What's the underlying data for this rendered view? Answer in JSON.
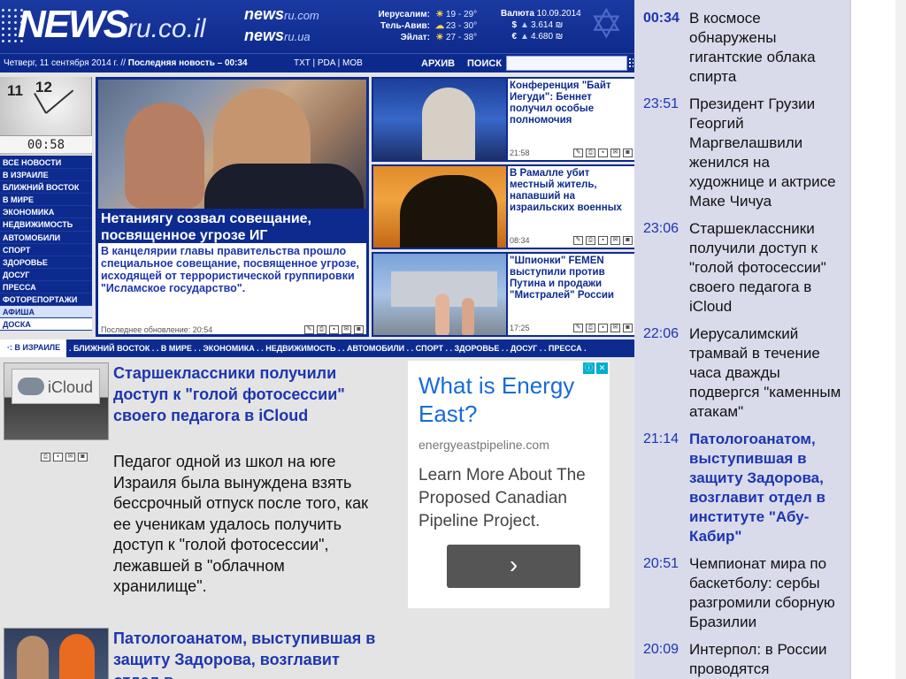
{
  "header": {
    "logo_bold": "NEWS",
    "logo_suffix": "ru.co.il",
    "mirrors": [
      {
        "bold": "news",
        "suffix": "ru.com"
      },
      {
        "bold": "news",
        "suffix": "ru.ua"
      }
    ],
    "weather": [
      {
        "city": "Иерусалим:",
        "icon": "sun-icon",
        "temp": "19 - 29°"
      },
      {
        "city": "Тель-Авив:",
        "icon": "sun-cloud-icon",
        "temp": "23 - 30°"
      },
      {
        "city": "Эйлат:",
        "icon": "sun-icon",
        "temp": "27 - 38°"
      }
    ],
    "currency": {
      "title": "Валюта",
      "date": "10.09.2014",
      "rows": [
        {
          "sym": "$",
          "dir": "up",
          "value": "3.614 ₪"
        },
        {
          "sym": "€",
          "dir": "up",
          "value": "4.680 ₪"
        }
      ]
    }
  },
  "topbar": {
    "date": "Четверг, 11 сентября 2014 г. //",
    "latest": "Последняя новость – 00:34",
    "formats": "TXT | PDA | MOB",
    "archive": "АРХИВ",
    "search": "ПОИСК",
    "search_value": ""
  },
  "clock": {
    "time": "00:58",
    "numbers": [
      "11",
      "12"
    ]
  },
  "nav": {
    "items": [
      "ВСЕ НОВОСТИ",
      "В ИЗРАИЛЕ",
      "БЛИЖНИЙ ВОСТОК",
      "В МИРЕ",
      "ЭКОНОМИКА",
      "НЕДВИЖИМОСТЬ",
      "АВТОМОБИЛИ",
      "СПОРТ",
      "ЗДОРОВЬЕ",
      "ДОСУГ",
      "ПРЕССА",
      "ФОТОРЕПОРТАЖИ",
      "АФИША",
      "ДОСКА"
    ]
  },
  "main_story": {
    "title": "Нетаниягу созвал совещание, посвященное угрозе ИГ",
    "text": "В канцелярии главы правительства прошло специальное совещание, посвященное угрозе, исходящей от террористической группировки \"Исламское государство\".",
    "updated": "Последнее обновление: 20:54"
  },
  "side_stories": [
    {
      "title": "Конференция \"Байт Иегуди\": Беннет получил особые полномочия",
      "time": "21:58"
    },
    {
      "title": "В Рамалле убит местный житель, напавший на израильских военных",
      "time": "08:34"
    },
    {
      "title": "\"Шпионки\" FEMEN выступили против Путина и продажи \"Мистралей\" России",
      "time": "17:25"
    }
  ],
  "catbar": {
    "current": "В ИЗРАИЛЕ",
    "rest": ". БЛИЖНИЙ ВОСТОК . . В МИРЕ . . ЭКОНОМИКА . . НЕДВИЖИМОСТЬ . . АВТОМОБИЛИ . . СПОРТ . . ЗДОРОВЬЕ . . ДОСУГ . . ПРЕССА ."
  },
  "articles": [
    {
      "title": "Старшеклассники получили доступ к \"голой фотосессии\" своего педагога в iCloud",
      "text": "Педагог одной из школ на юге Израиля была вынуждена взять бессрочный отпуск после того, как ее ученикам удалось получить доступ к \"голой фотосессии\", лежавшей в \"облачном хранилище\".",
      "thumb_label": "iCloud"
    },
    {
      "title": "Патологоанатом, выступившая в защиту Задорова, возглавит отдел в"
    }
  ],
  "ad": {
    "headline": "What is Energy East?",
    "url": "energyeastpipeline.com",
    "text": "Learn More About The Proposed Canadian Pipeline Project.",
    "button": "›"
  },
  "news_feed": [
    {
      "time": "00:34",
      "title": "В космосе обнаружены гигантские облака спирта",
      "highlight": false
    },
    {
      "time": "23:51",
      "title": "Президент Грузии Георгий Маргвелашвили женился на художнице и актрисе Маке Чичуа",
      "highlight": false
    },
    {
      "time": "23:06",
      "title": "Старшеклассники получили доступ к \"голой фотосессии\" своего педагога в iCloud",
      "highlight": false
    },
    {
      "time": "22:06",
      "title": "Иерусалимский трамвай в течение часа дважды подвергся \"каменным атакам\"",
      "highlight": false
    },
    {
      "time": "21:14",
      "title": "Патологоанатом, выступившая в защиту Задорова, возглавит отдел в институте \"Абу-Кабир\"",
      "highlight": true
    },
    {
      "time": "20:51",
      "title": "Чемпионат мира по баскетболу: сербы разгромили сборную Бразилии",
      "highlight": false
    },
    {
      "time": "20:09",
      "title": "Интерпол: в России проводятся",
      "highlight": false
    }
  ],
  "colors": {
    "brand_blue": "#0d2b8f",
    "link_blue": "#1d35b0",
    "feed_bg": "#d9dbeb"
  }
}
